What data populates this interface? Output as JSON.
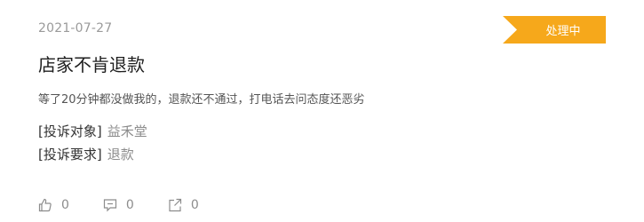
{
  "complaint": {
    "date": "2021-07-27",
    "status": "处理中",
    "title": "店家不肯退款",
    "content": "等了20分钟都没做我的，退款还不通过，打电话去问态度还恶劣",
    "target_label": "[投诉对象]",
    "target_value": "益禾堂",
    "request_label": "[投诉要求]",
    "request_value": "退款"
  },
  "actions": {
    "like_count": "0",
    "comment_count": "0",
    "share_count": "0",
    "like_icon": "thumb-up-icon",
    "comment_icon": "comment-icon",
    "share_icon": "share-icon"
  },
  "colors": {
    "status_badge": "#f6a81b",
    "muted": "#9a9a9a"
  }
}
